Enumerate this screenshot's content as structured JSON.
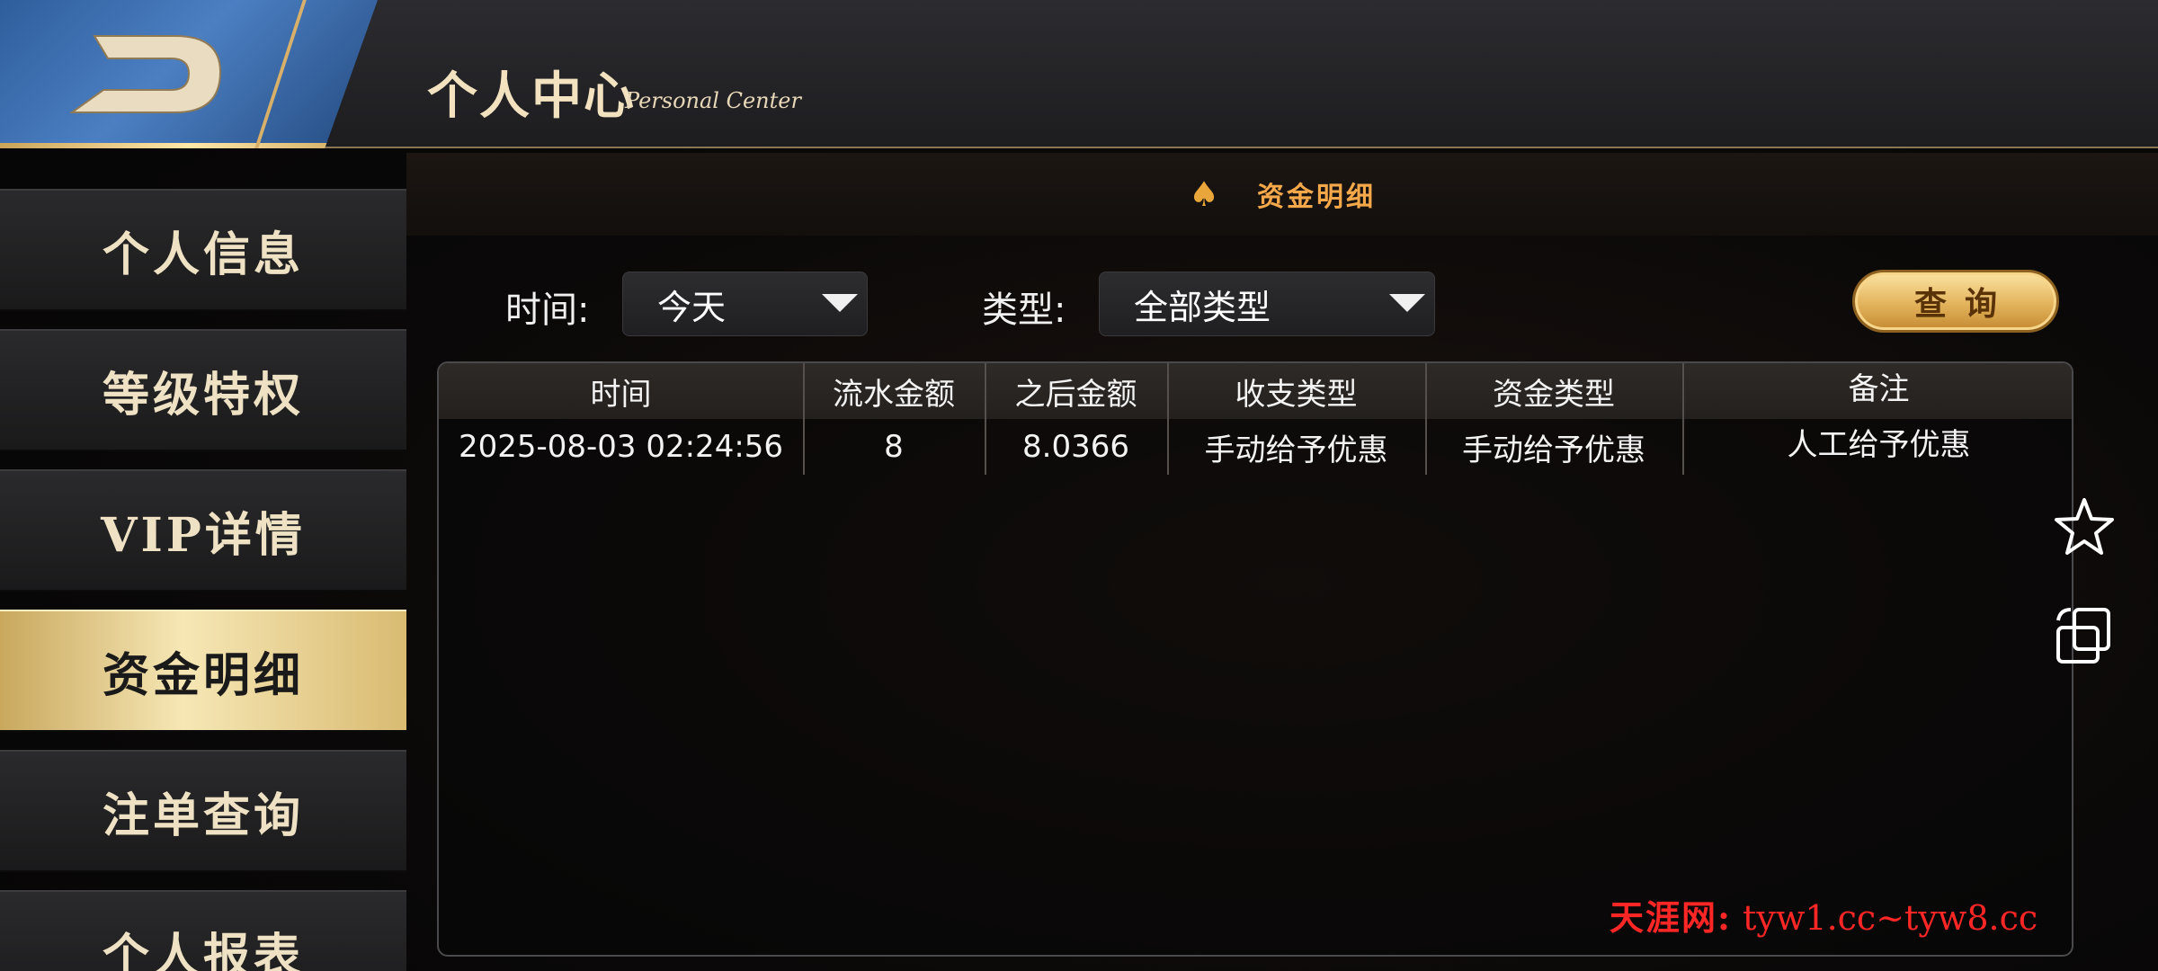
{
  "header": {
    "title": "个人中心",
    "subtitle": "Personal Center"
  },
  "sidebar": {
    "items": [
      {
        "label": "个人信息",
        "active": false
      },
      {
        "label": "等级特权",
        "active": false
      },
      {
        "label": "VIP详情",
        "active": false
      },
      {
        "label": "资金明细",
        "active": true
      },
      {
        "label": "注单查询",
        "active": false
      },
      {
        "label": "个人报表",
        "active": false
      }
    ]
  },
  "section": {
    "title": "资金明细",
    "icon": "spade-icon"
  },
  "filters": {
    "time_label": "时间:",
    "time_value": "今天",
    "type_label": "类型:",
    "type_value": "全部类型",
    "query_label": "查询"
  },
  "table": {
    "columns": [
      "时间",
      "流水金额",
      "之后金额",
      "收支类型",
      "资金类型",
      "备注"
    ],
    "rows": [
      [
        "2025-08-03 02:24:56",
        "8",
        "8.0366",
        "手动给予优惠",
        "手动给予优惠",
        "人工给予优惠"
      ]
    ]
  },
  "right_icons": [
    "star-icon",
    "rotate-screen-icon"
  ],
  "watermark": {
    "site": "天涯网:",
    "domains": "tyw1.cc~tyw8.cc"
  },
  "colors": {
    "accent_gold": "#e3b45c",
    "section_title": "#f5a84a",
    "watermark": "#ff2626"
  }
}
